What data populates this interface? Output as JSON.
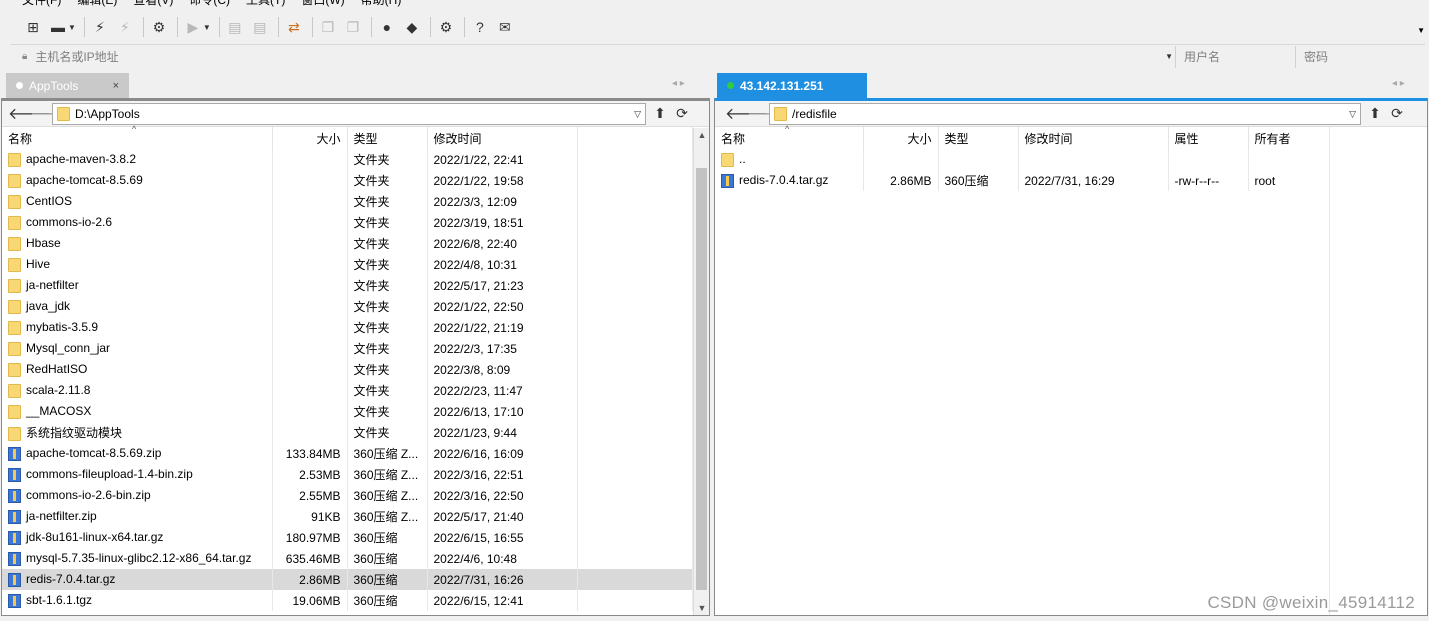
{
  "menu": [
    "文件(F)",
    "编辑(E)",
    "查看(V)",
    "命令(C)",
    "工具(T)",
    "窗口(W)",
    "帮助(H)"
  ],
  "address": {
    "host_placeholder": "主机名或IP地址",
    "user_placeholder": "用户名",
    "pass_placeholder": "密码"
  },
  "left": {
    "tab_label": "AppTools",
    "tab_close": "×",
    "path": "D:\\AppTools",
    "columns": [
      "名称",
      "大小",
      "类型",
      "修改时间"
    ],
    "rows": [
      {
        "icon": "folder-icon",
        "name": "apache-maven-3.8.2",
        "size": "",
        "type": "文件夹",
        "mtime": "2022/1/22, 22:41"
      },
      {
        "icon": "folder-icon",
        "name": "apache-tomcat-8.5.69",
        "size": "",
        "type": "文件夹",
        "mtime": "2022/1/22, 19:58"
      },
      {
        "icon": "folder-icon",
        "name": "CentIOS",
        "size": "",
        "type": "文件夹",
        "mtime": "2022/3/3, 12:09"
      },
      {
        "icon": "folder-icon",
        "name": "commons-io-2.6",
        "size": "",
        "type": "文件夹",
        "mtime": "2022/3/19, 18:51"
      },
      {
        "icon": "folder-icon",
        "name": "Hbase",
        "size": "",
        "type": "文件夹",
        "mtime": "2022/6/8, 22:40"
      },
      {
        "icon": "folder-icon",
        "name": "Hive",
        "size": "",
        "type": "文件夹",
        "mtime": "2022/4/8, 10:31"
      },
      {
        "icon": "folder-icon",
        "name": "ja-netfilter",
        "size": "",
        "type": "文件夹",
        "mtime": "2022/5/17, 21:23"
      },
      {
        "icon": "folder-icon",
        "name": "java_jdk",
        "size": "",
        "type": "文件夹",
        "mtime": "2022/1/22, 22:50"
      },
      {
        "icon": "folder-icon",
        "name": "mybatis-3.5.9",
        "size": "",
        "type": "文件夹",
        "mtime": "2022/1/22, 21:19"
      },
      {
        "icon": "folder-icon",
        "name": "Mysql_conn_jar",
        "size": "",
        "type": "文件夹",
        "mtime": "2022/2/3, 17:35"
      },
      {
        "icon": "folder-icon",
        "name": "RedHatISO",
        "size": "",
        "type": "文件夹",
        "mtime": "2022/3/8, 8:09"
      },
      {
        "icon": "folder-icon",
        "name": "scala-2.11.8",
        "size": "",
        "type": "文件夹",
        "mtime": "2022/2/23, 11:47"
      },
      {
        "icon": "folder-icon",
        "name": "__MACOSX",
        "size": "",
        "type": "文件夹",
        "mtime": "2022/6/13, 17:10"
      },
      {
        "icon": "folder-icon",
        "name": "系统指纹驱动模块",
        "size": "",
        "type": "文件夹",
        "mtime": "2022/1/23, 9:44"
      },
      {
        "icon": "archive-icon",
        "name": "apache-tomcat-8.5.69.zip",
        "size": "133.84MB",
        "type": "360压缩 Z...",
        "mtime": "2022/6/16, 16:09"
      },
      {
        "icon": "archive-icon",
        "name": "commons-fileupload-1.4-bin.zip",
        "size": "2.53MB",
        "type": "360压缩 Z...",
        "mtime": "2022/3/16, 22:51"
      },
      {
        "icon": "archive-icon",
        "name": "commons-io-2.6-bin.zip",
        "size": "2.55MB",
        "type": "360压缩 Z...",
        "mtime": "2022/3/16, 22:50"
      },
      {
        "icon": "archive-icon",
        "name": "ja-netfilter.zip",
        "size": "91KB",
        "type": "360压缩 Z...",
        "mtime": "2022/5/17, 21:40"
      },
      {
        "icon": "archive-icon",
        "name": "jdk-8u161-linux-x64.tar.gz",
        "size": "180.97MB",
        "type": "360压缩",
        "mtime": "2022/6/15, 16:55"
      },
      {
        "icon": "archive-icon",
        "name": "mysql-5.7.35-linux-glibc2.12-x86_64.tar.gz",
        "size": "635.46MB",
        "type": "360压缩",
        "mtime": "2022/4/6, 10:48"
      },
      {
        "icon": "archive-icon",
        "name": "redis-7.0.4.tar.gz",
        "size": "2.86MB",
        "type": "360压缩",
        "mtime": "2022/7/31, 16:26",
        "selected": true
      },
      {
        "icon": "archive-icon",
        "name": "sbt-1.6.1.tgz",
        "size": "19.06MB",
        "type": "360压缩",
        "mtime": "2022/6/15, 12:41"
      }
    ]
  },
  "right": {
    "tab_label": "43.142.131.251",
    "path": "/redisfile",
    "columns": [
      "名称",
      "大小",
      "类型",
      "修改时间",
      "属性",
      "所有者"
    ],
    "rows": [
      {
        "icon": "folder-icon",
        "name": "..",
        "size": "",
        "type": "",
        "mtime": "",
        "attr": "",
        "owner": ""
      },
      {
        "icon": "archive-icon",
        "name": "redis-7.0.4.tar.gz",
        "size": "2.86MB",
        "type": "360压缩",
        "mtime": "2022/7/31, 16:29",
        "attr": "-rw-r--r--",
        "owner": "root"
      }
    ]
  },
  "watermark": "CSDN @weixin_45914112"
}
